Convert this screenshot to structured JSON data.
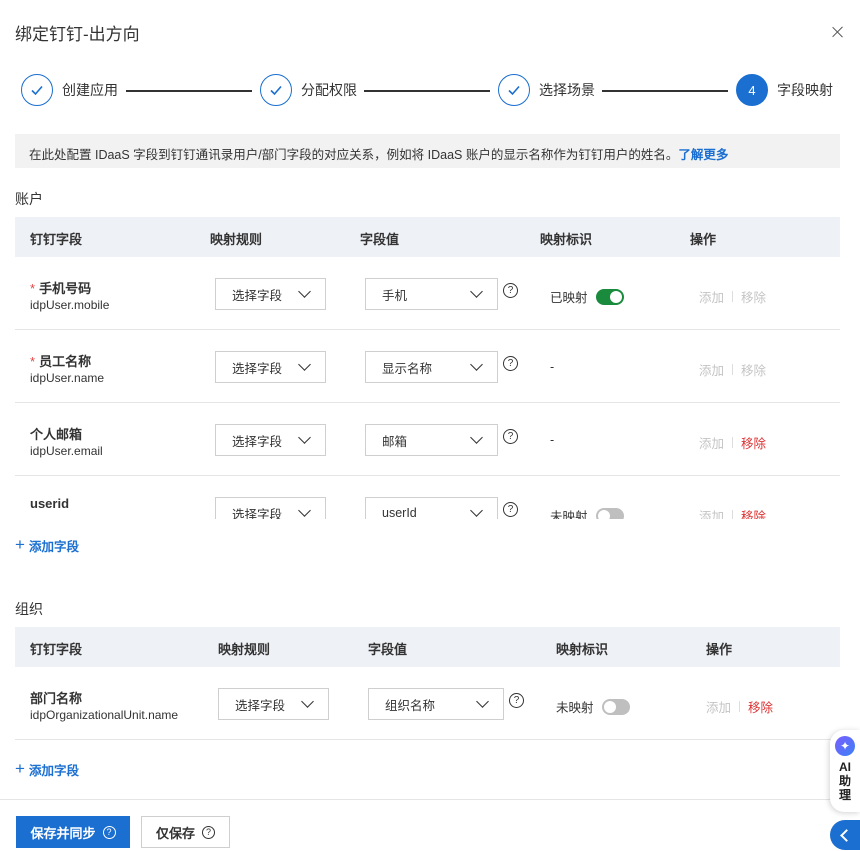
{
  "dialog": {
    "title": "绑定钉钉-出方向"
  },
  "steps": [
    {
      "label": "创建应用",
      "state": "done"
    },
    {
      "label": "分配权限",
      "state": "done"
    },
    {
      "label": "选择场景",
      "state": "done"
    },
    {
      "label": "字段映射",
      "state": "current",
      "number": "4"
    }
  ],
  "info": {
    "text": "在此处配置 IDaaS 字段到钉钉通讯录用户/部门字段的对应关系，例如将 IDaaS 账户的显示名称作为钉钉用户的姓名。",
    "link": "了解更多"
  },
  "account_section": {
    "title": "账户",
    "columns": [
      "钉钉字段",
      "映射规则",
      "字段值",
      "映射标识",
      "操作"
    ],
    "rows": [
      {
        "name": "手机号码",
        "required": "*",
        "key": "idpUser.mobile",
        "rule": "选择字段",
        "value": "手机",
        "mapping": "已映射",
        "toggle": "on",
        "add": "添加",
        "remove": "移除"
      },
      {
        "name": "员工名称",
        "required": "*",
        "key": "idpUser.name",
        "rule": "选择字段",
        "value": "显示名称",
        "mapping": "-",
        "add": "添加",
        "remove": "移除"
      },
      {
        "name": "个人邮箱",
        "required": "",
        "key": "idpUser.email",
        "rule": "选择字段",
        "value": "邮箱",
        "mapping": "-",
        "add": "添加",
        "remove": "移除"
      },
      {
        "name": "userid",
        "required": "",
        "key": "",
        "rule": "选择字段",
        "value": "userId",
        "mapping": "未映射",
        "toggle": "off",
        "add": "添加",
        "remove": "移除"
      }
    ],
    "add_field": "添加字段"
  },
  "org_section": {
    "title": "组织",
    "columns": [
      "钉钉字段",
      "映射规则",
      "字段值",
      "映射标识",
      "操作"
    ],
    "rows": [
      {
        "name": "部门名称",
        "key": "idpOrganizationalUnit.name",
        "rule": "选择字段",
        "value": "组织名称",
        "mapping": "未映射",
        "toggle": "off",
        "add": "添加",
        "remove": "移除"
      }
    ],
    "add_field": "添加字段"
  },
  "footer": {
    "save_sync": "保存并同步",
    "save_only": "仅保存"
  },
  "ai_assistant": {
    "label_1": "AI",
    "label_2": "助",
    "label_3": "理"
  },
  "icons": {
    "close": "close-icon",
    "check": "check-icon",
    "chevron": "chevron-down-icon",
    "help": "help-circle-icon",
    "plus": "plus-icon",
    "ai": "ai-logo-icon",
    "collapse": "chevron-left-icon"
  },
  "colors": {
    "primary": "#1a6fd0",
    "toggle_on": "#1a8a3c",
    "danger": "#d33333",
    "disabled": "#c4c4c4"
  }
}
